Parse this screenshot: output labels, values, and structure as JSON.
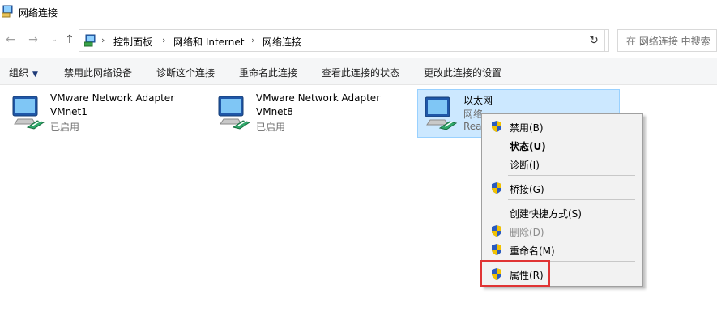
{
  "window": {
    "title": "网络连接"
  },
  "address": {
    "crumbs": [
      "控制面板",
      "网络和 Internet",
      "网络连接"
    ],
    "search_placeholder": "在 网络连接 中搜索"
  },
  "commands": {
    "organize": "组织",
    "disable": "禁用此网络设备",
    "diagnose": "诊断这个连接",
    "rename": "重命名此连接",
    "status": "查看此连接的状态",
    "settings": "更改此连接的设置"
  },
  "adapters": [
    {
      "line1": "VMware Network Adapter",
      "line2": "VMnet1",
      "line3": "已启用"
    },
    {
      "line1": "VMware Network Adapter",
      "line2": "VMnet8",
      "line3": "已启用"
    },
    {
      "line1": "以太网",
      "line2": "网络",
      "line3": "Rea"
    }
  ],
  "context_menu": {
    "disable": "禁用(B)",
    "status": "状态(U)",
    "diagnose": "诊断(I)",
    "bridge": "桥接(G)",
    "shortcut": "创建快捷方式(S)",
    "delete": "删除(D)",
    "rename": "重命名(M)",
    "properties": "属性(R)"
  },
  "colors": {
    "selection_bg": "#cce8ff",
    "selection_border": "#99d1ff",
    "highlight_box": "#e03434",
    "shield_blue": "#2a5bbf",
    "shield_yellow": "#f2c200"
  }
}
